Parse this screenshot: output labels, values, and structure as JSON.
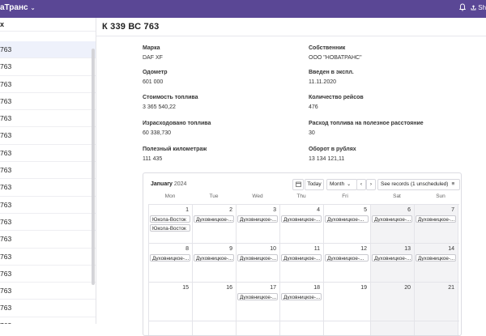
{
  "topbar": {
    "app_title": "аТранс",
    "share_label": "Sh"
  },
  "sidebar": {
    "header": "x",
    "subheader": "",
    "items": [
      {
        "label": "763"
      },
      {
        "label": "763"
      },
      {
        "label": "763"
      },
      {
        "label": "763"
      },
      {
        "label": "763"
      },
      {
        "label": "763"
      },
      {
        "label": "763"
      },
      {
        "label": "763"
      },
      {
        "label": "763"
      },
      {
        "label": "763"
      },
      {
        "label": "763"
      },
      {
        "label": "763"
      },
      {
        "label": "763"
      },
      {
        "label": "763"
      },
      {
        "label": "763"
      },
      {
        "label": "763"
      },
      {
        "label": "763"
      }
    ]
  },
  "record": {
    "title": "К 339 ВС 763",
    "fields": {
      "brand": {
        "label": "Марка",
        "value": "DAF XF"
      },
      "owner": {
        "label": "Собственник",
        "value": "ООО \"НОВАТРАНС\""
      },
      "odometer": {
        "label": "Одометр",
        "value": "601 000"
      },
      "commissioned": {
        "label": "Введен в экспл.",
        "value": "11.11.2020"
      },
      "fuel_cost": {
        "label": "Стоимость топлива",
        "value": "3 365 540,22"
      },
      "trips": {
        "label": "Количество рейсов",
        "value": "476"
      },
      "fuel_used": {
        "label": "Израсходовано топлива",
        "value": "60 338,730"
      },
      "fuel_rate": {
        "label": "Расход топлива на полезное расстояние",
        "value": "30"
      },
      "useful_km": {
        "label": "Полезный километраж",
        "value": "111 435"
      },
      "turnover": {
        "label": "Оборот в рублях",
        "value": "13 134 121,11"
      }
    }
  },
  "calendar": {
    "month": "January",
    "year": "2024",
    "today_label": "Today",
    "view_label": "Month",
    "records_label": "See records (1 unscheduled)",
    "weekdays": [
      "Mon",
      "Tue",
      "Wed",
      "Thu",
      "Fri",
      "Sat",
      "Sun"
    ],
    "days": [
      {
        "n": "1",
        "events": [
          "Юкола-Восток",
          "Юкола-Восток"
        ]
      },
      {
        "n": "2",
        "events": [
          "Духовницкое-..."
        ]
      },
      {
        "n": "3",
        "events": [
          "Духовницкое-..."
        ]
      },
      {
        "n": "4",
        "events": [
          "Духовницкое-..."
        ]
      },
      {
        "n": "5",
        "events": [
          "Духовницкое-..."
        ]
      },
      {
        "n": "6",
        "events": [
          "Духовницкое-..."
        ]
      },
      {
        "n": "7",
        "events": [
          "Духовницкое-..."
        ]
      },
      {
        "n": "8",
        "events": [
          "Духовницкое-..."
        ]
      },
      {
        "n": "9",
        "events": [
          "Духовницкое-..."
        ]
      },
      {
        "n": "10",
        "events": [
          "Духовницкое-..."
        ]
      },
      {
        "n": "11",
        "events": [
          "Духовницкое-..."
        ]
      },
      {
        "n": "12",
        "events": [
          "Духовницкое-..."
        ]
      },
      {
        "n": "13",
        "events": [
          "Духовницкое-..."
        ]
      },
      {
        "n": "14",
        "events": [
          "Духовницкое-..."
        ]
      },
      {
        "n": "15",
        "events": []
      },
      {
        "n": "16",
        "events": []
      },
      {
        "n": "17",
        "events": [
          "Духовницкое-..."
        ]
      },
      {
        "n": "18",
        "events": [
          "Духовницкое-..."
        ]
      },
      {
        "n": "19",
        "events": []
      },
      {
        "n": "20",
        "events": []
      },
      {
        "n": "21",
        "events": []
      }
    ]
  }
}
